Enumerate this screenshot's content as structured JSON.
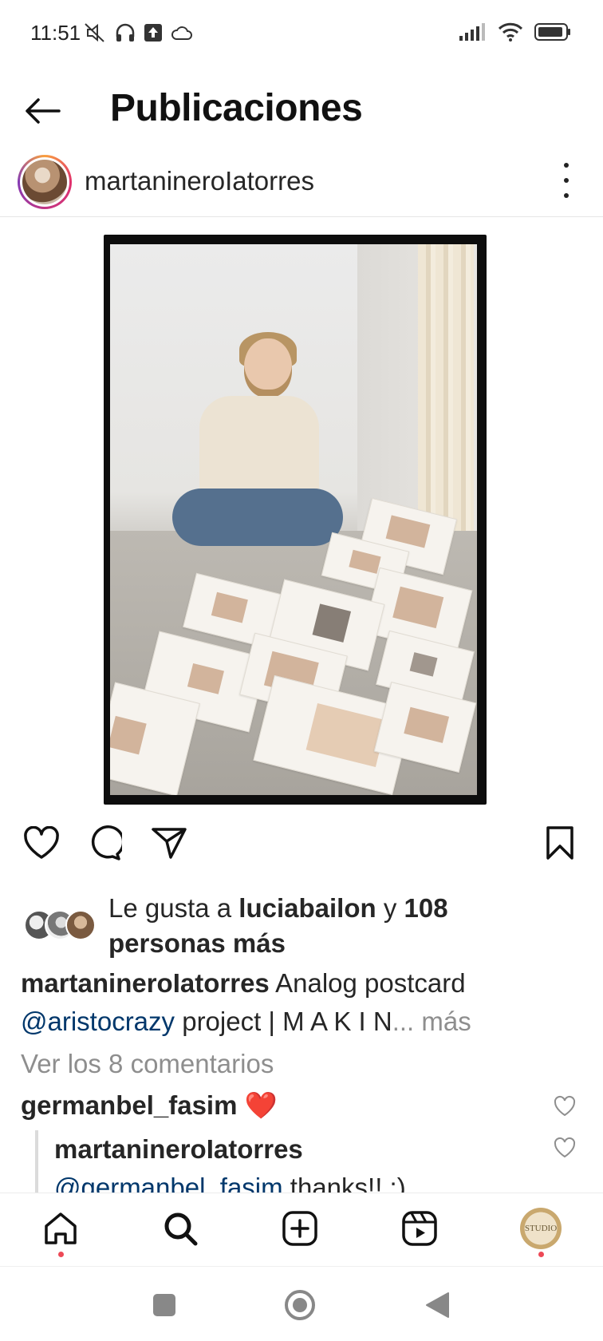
{
  "status_bar": {
    "time": "11:51",
    "left_icons": [
      "mute-icon",
      "headphones-icon",
      "upload-icon",
      "cloud-icon"
    ],
    "right_icons": [
      "signal-icon",
      "wifi-icon",
      "battery-icon"
    ]
  },
  "header": {
    "title": "Publicaciones",
    "back_icon": "arrow-left-icon"
  },
  "post": {
    "username": "martanineroIatorres",
    "more_icon": "more-vertical-icon"
  },
  "actions": {
    "like_icon": "heart-icon",
    "comment_icon": "comment-icon",
    "share_icon": "send-icon",
    "save_icon": "bookmark-icon"
  },
  "likes": {
    "prefix": "Le gusta a ",
    "user": "luciabailon",
    "middle": " y ",
    "count": "108",
    "suffix": "personas más"
  },
  "caption": {
    "username": "martanineroIatorres",
    "text": " Analog postcard",
    "mention": "@aristocrazy",
    "text2": " project | M A K I N",
    "more": "... más"
  },
  "view_comments": "Ver los 8 comentarios",
  "comments": [
    {
      "username": "germanbel_fasim",
      "text": "❤️"
    }
  ],
  "reply": {
    "username": "martanineroIatorres",
    "mention": "@germanbel_fasim",
    "text": " thanks!! :)"
  },
  "bottom_nav": {
    "items": [
      "home-icon",
      "search-icon",
      "add-icon",
      "reels-icon",
      "profile-avatar"
    ],
    "profile_label": "STUDIO"
  },
  "colors": {
    "mention": "#00376b",
    "muted": "#8e8e8e",
    "notification_dot": "#ed4956"
  }
}
